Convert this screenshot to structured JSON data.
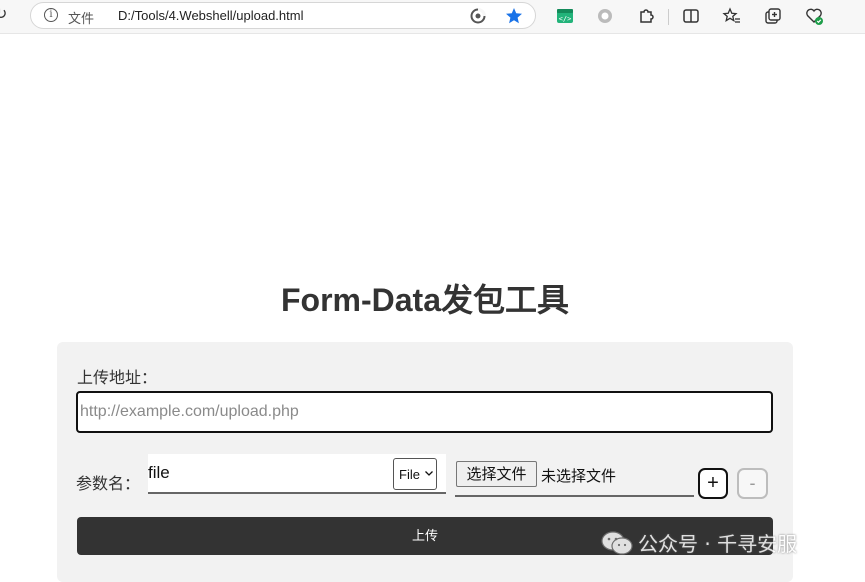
{
  "browser": {
    "file_label": "文件",
    "url": "D:/Tools/4.Webshell/upload.html",
    "address_icons": [
      "info-icon",
      "edge-refresh-icon",
      "favorite-star-icon"
    ],
    "toolbar_icons": [
      "code-extension-icon",
      "record-extension-icon",
      "extensions-puzzle-icon",
      "split-screen-icon",
      "favorites-icon",
      "collections-icon",
      "browser-health-icon"
    ],
    "accent_color": "#1a73e8"
  },
  "page": {
    "title": "Form-Data发包工具",
    "url_label": "上传地址：",
    "url_placeholder": "http://example.com/upload.php",
    "param_label": "参数名：",
    "param_value": "file",
    "type_value": "File",
    "choose_file_label": "选择文件",
    "no_file_label": "未选择文件",
    "add_label": "+",
    "remove_label": "-",
    "upload_label": "上传"
  },
  "watermark": {
    "text": "公众号 · 千寻安服"
  }
}
